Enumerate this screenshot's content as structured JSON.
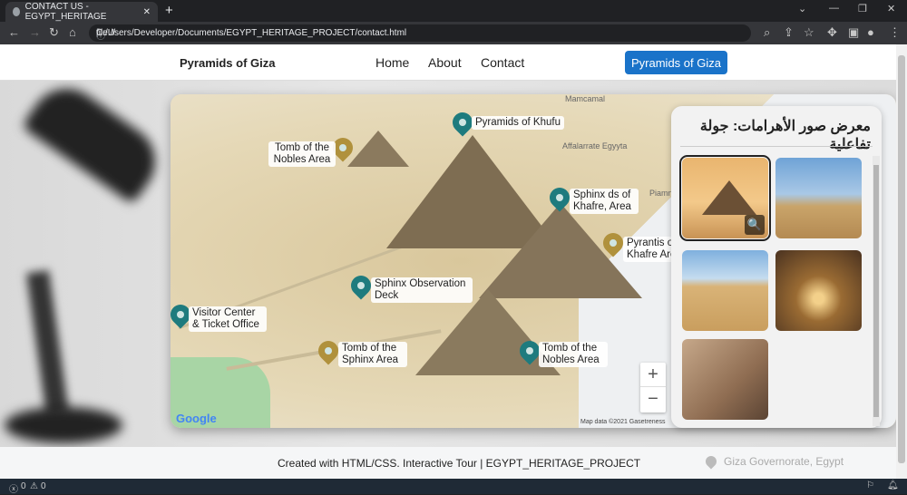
{
  "browser": {
    "tab_title": "CONTACT US - EGYPT_HERITAGE",
    "url_scheme": "file://",
    "url_path": "C:/Users/Developer/Documents/EGYPT_HERITAGE_PROJECT/contact.html"
  },
  "nav": {
    "brand": "Pyramids of Giza",
    "links": [
      "Home",
      "About",
      "Contact"
    ],
    "button": "Pyramids of Giza"
  },
  "map": {
    "markers": [
      {
        "label": "Pyramids of Khufu",
        "color": "teal"
      },
      {
        "label": "Tomb of the Nobles Area",
        "color": "gold"
      },
      {
        "label": "Sphinx ds of Khafre, Area",
        "color": "teal"
      },
      {
        "label": "Pyrantis of Khafre Area",
        "color": "gold"
      },
      {
        "label": "Sphinx Observation Deck",
        "color": "teal"
      },
      {
        "label": "Visitor Center & Ticket Office",
        "color": "teal"
      },
      {
        "label": "Tomb of the Sphinx Area",
        "color": "gold"
      },
      {
        "label": "Tomb of the Nobles Area",
        "color": "teal"
      }
    ],
    "places": [
      "Mamcamal",
      "Affalarrate Egyyta",
      "Piamnal Sta"
    ],
    "zoom_in": "+",
    "zoom_out": "−",
    "logo": "Google",
    "attribution": "Map data ©2021 Gasetreness"
  },
  "gallery": {
    "title": "معرض صور الأهرامات: جولة تفاعلية",
    "zoom_icon": "🔍"
  },
  "footer": {
    "text": "Created with HTML/CSS. Interactive Tour | EGYPT_HERITAGE_PROJECT",
    "location": "Giza Governorate, Egypt"
  },
  "statusbar": {
    "errors": "0",
    "warnings": "0"
  },
  "colors": {
    "accent": "#1a73c9",
    "teal": "#1e7b7e",
    "gold": "#b0913c"
  }
}
